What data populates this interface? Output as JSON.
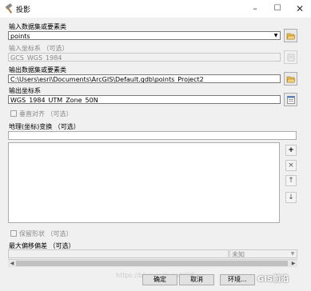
{
  "window": {
    "title": "投影"
  },
  "fields": {
    "input_dataset_label": "输入数据集或要素类",
    "input_dataset_value": "points",
    "input_crs_label": "输入坐标系 （可选）",
    "input_crs_value": "GCS_WGS_1984",
    "output_dataset_label": "输出数据集或要素类",
    "output_dataset_value": "C:\\Users\\esri\\Documents\\ArcGIS\\Default.gdb\\points_Project2",
    "output_crs_label": "输出坐标系",
    "output_crs_value": "WGS_1984_UTM_Zone_50N",
    "vertical_label": "垂直对齐 （可选）",
    "transform_label": "地理(坐标)变换 （可选）",
    "preserve_shape_label": "保留形状 （可选）",
    "max_offset_label": "最大偏移偏差 （可选）",
    "max_offset_unit": "未知"
  },
  "side_buttons": {
    "add": "+",
    "remove": "×",
    "up": "↑",
    "down": "↓"
  },
  "buttons": {
    "ok": "确定",
    "cancel": "取消",
    "env": "环境..."
  },
  "watermark": {
    "url": "https://blog.csdn.net/GIS",
    "brand": "GIS前沿"
  }
}
